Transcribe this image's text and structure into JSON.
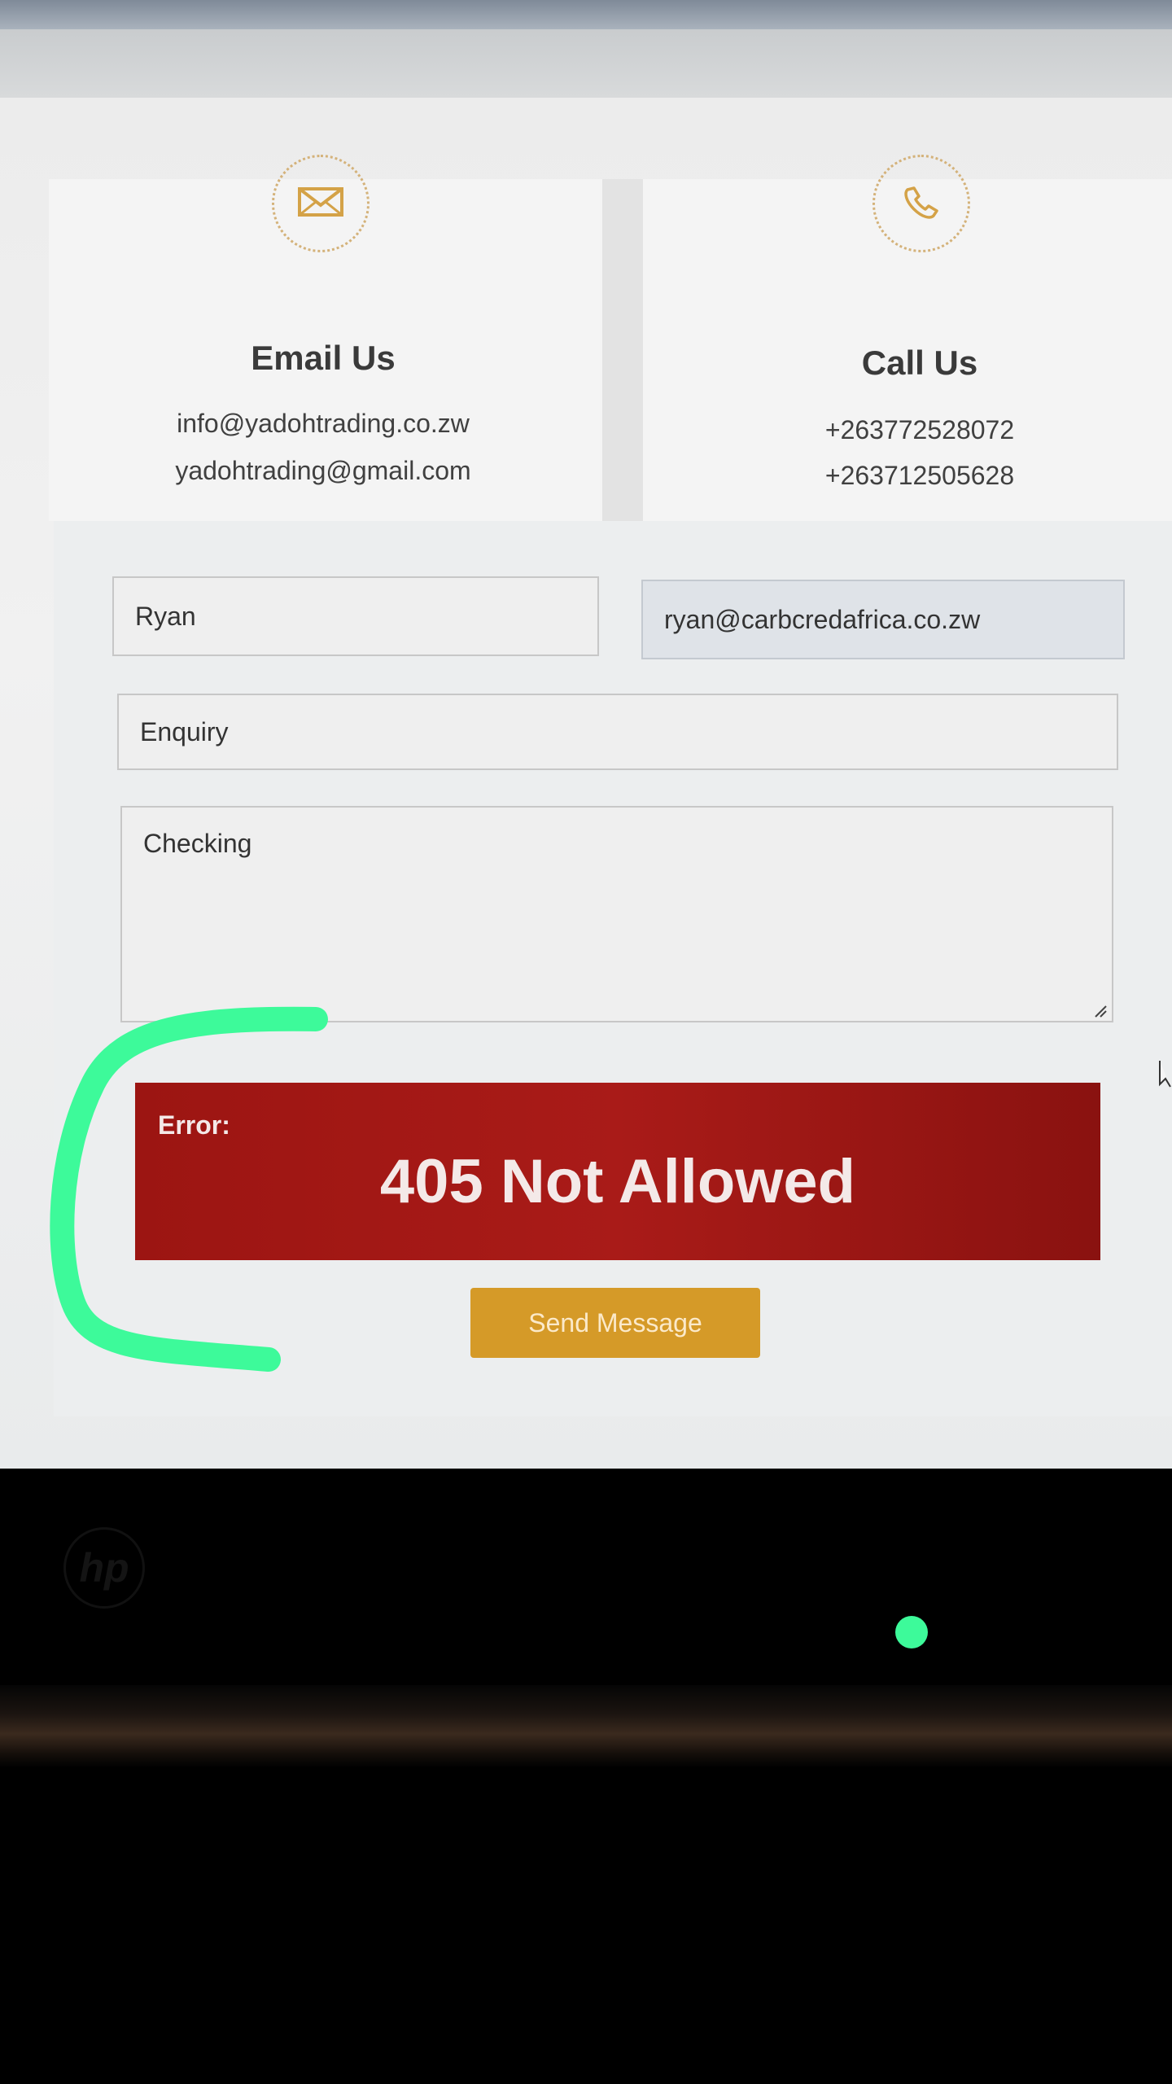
{
  "contact": {
    "email": {
      "title": "Email Us",
      "lines": [
        "info@yadohtrading.co.zw",
        "yadohtrading@gmail.com"
      ],
      "icon": "envelope-icon"
    },
    "call": {
      "title": "Call Us",
      "lines": [
        "+263772528072",
        "+263712505628"
      ],
      "icon": "phone-icon"
    }
  },
  "form": {
    "name_value": "Ryan",
    "email_value": "ryan@carbcredafrica.co.zw",
    "subject_value": "Enquiry",
    "message_value": "Checking",
    "send_label": "Send Message"
  },
  "error": {
    "label": "Error:",
    "title": "405 Not Allowed"
  },
  "colors": {
    "accent": "#d59a28",
    "error_bg": "#a31916",
    "annotation": "#3dfa9a"
  }
}
